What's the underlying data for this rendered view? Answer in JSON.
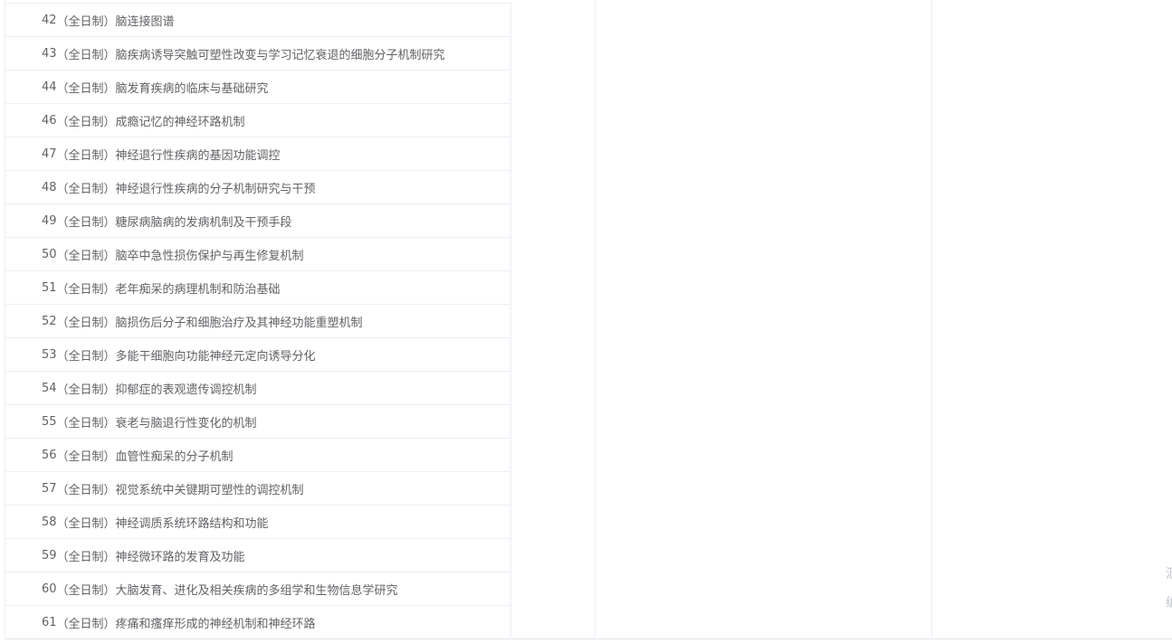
{
  "table": {
    "rows": [
      {
        "num": "42",
        "label": "（全日制）脑连接图谱"
      },
      {
        "num": "43",
        "label": "（全日制）脑疾病诱导突触可塑性改变与学习记忆衰退的细胞分子机制研究"
      },
      {
        "num": "44",
        "label": "（全日制）脑发育疾病的临床与基础研究"
      },
      {
        "num": "46",
        "label": "（全日制）成瘾记忆的神经环路机制"
      },
      {
        "num": "47",
        "label": "（全日制）神经退行性疾病的基因功能调控"
      },
      {
        "num": "48",
        "label": "（全日制）神经退行性疾病的分子机制研究与干预"
      },
      {
        "num": "49",
        "label": "（全日制）糖尿病脑病的发病机制及干预手段"
      },
      {
        "num": "50",
        "label": "（全日制）脑卒中急性损伤保护与再生修复机制"
      },
      {
        "num": "51",
        "label": "（全日制）老年痴呆的病理机制和防治基础"
      },
      {
        "num": "52",
        "label": "（全日制）脑损伤后分子和细胞治疗及其神经功能重塑机制"
      },
      {
        "num": "53",
        "label": "（全日制）多能干细胞向功能神经元定向诱导分化"
      },
      {
        "num": "54",
        "label": "（全日制）抑郁症的表观遗传调控机制"
      },
      {
        "num": "55",
        "label": "（全日制）衰老与脑退行性变化的机制"
      },
      {
        "num": "56",
        "label": "（全日制）血管性痴呆的分子机制"
      },
      {
        "num": "57",
        "label": "（全日制）视觉系统中关键期可塑性的调控机制"
      },
      {
        "num": "58",
        "label": "（全日制）神经调质系统环路结构和功能"
      },
      {
        "num": "59",
        "label": "（全日制）神经微环路的发育及功能"
      },
      {
        "num": "60",
        "label": "（全日制）大脑发育、进化及相关疾病的多组学和生物信息学研究"
      },
      {
        "num": "61",
        "label": "（全日制）疼痛和瘙痒形成的神经机制和神经环路"
      }
    ]
  },
  "edge_glyphs": [
    "汇",
    "编"
  ]
}
